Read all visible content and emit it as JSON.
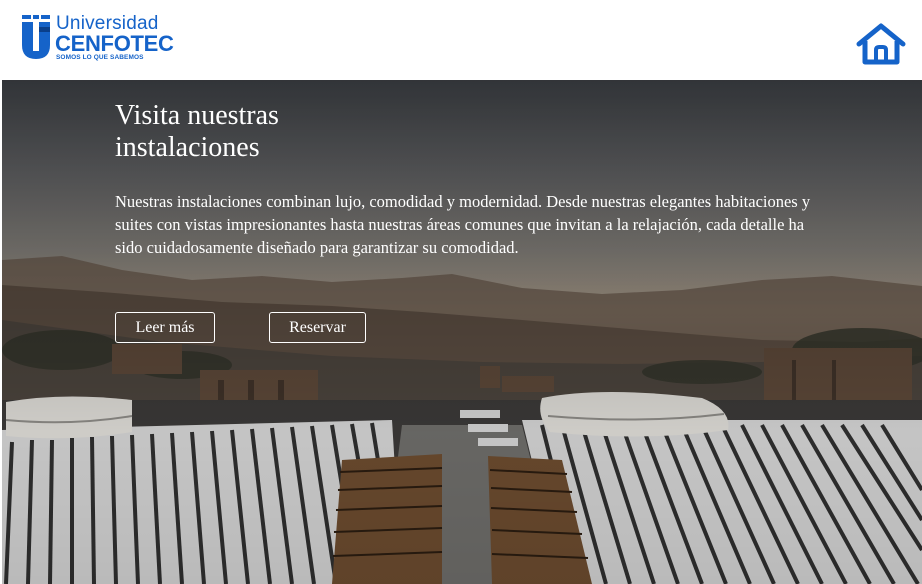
{
  "header": {
    "logo": {
      "line1": "Universidad",
      "line2": "CENFOTEC",
      "tagline": "SOMOS LO QUE SABEMOS",
      "color": "#1563c9"
    },
    "home_icon": "home-icon"
  },
  "hero": {
    "title_line1": "Visita nuestras",
    "title_line2": "instalaciones",
    "description": "Nuestras instalaciones combinan lujo, comodidad y modernidad. Desde nuestras elegantes habitaciones y suites con vistas impresionantes hasta nuestras áreas comunes que invitan a la relajación, cada detalle ha sido cuidadosamente diseñado para garantizar su comodidad.",
    "buttons": {
      "read_more": "Leer más",
      "reserve": "Reservar"
    }
  }
}
